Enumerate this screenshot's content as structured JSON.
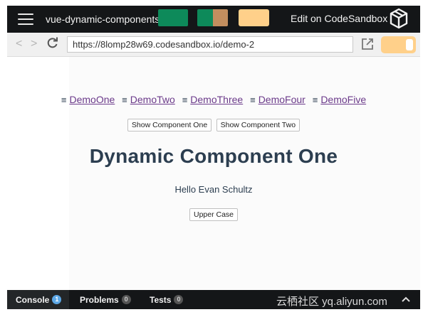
{
  "topbar": {
    "title": "vue-dynamic-components",
    "edit_link": "Edit on CodeSandbox",
    "swatch_colors": [
      "#0d8a5a",
      "#0d8a5a",
      "#c28e5f",
      "#ffd08a"
    ]
  },
  "browser": {
    "url": "https://8lomp28w69.codesandbox.io/demo-2",
    "back_icon": "<",
    "forward_icon": ">",
    "reload_icon": "C"
  },
  "demo_nav": {
    "items": [
      {
        "glyph": "≡",
        "label": "DemoOne"
      },
      {
        "glyph": "≡",
        "label": "DemoTwo"
      },
      {
        "glyph": "≡",
        "label": "DemoThree"
      },
      {
        "glyph": "≡",
        "label": "DemoFour"
      },
      {
        "glyph": "≡",
        "label": "DemoFive"
      }
    ]
  },
  "buttons": {
    "show_one": "Show Component One",
    "show_two": "Show Component Two",
    "upper_case": "Upper Case"
  },
  "content": {
    "heading": "Dynamic Component One",
    "greeting": "Hello Evan Schultz"
  },
  "bottom_tabs": [
    {
      "label": "Console",
      "count": "1"
    },
    {
      "label": "Problems",
      "count": "0"
    },
    {
      "label": "Tests",
      "count": "0"
    }
  ],
  "watermark": "云栖社区 yq.aliyun.com",
  "colors": {
    "heading": "#2c3e50",
    "link": "#6b3a8a",
    "accent_toggle": "#ffd08a",
    "badge_active": "#5da8e6"
  }
}
